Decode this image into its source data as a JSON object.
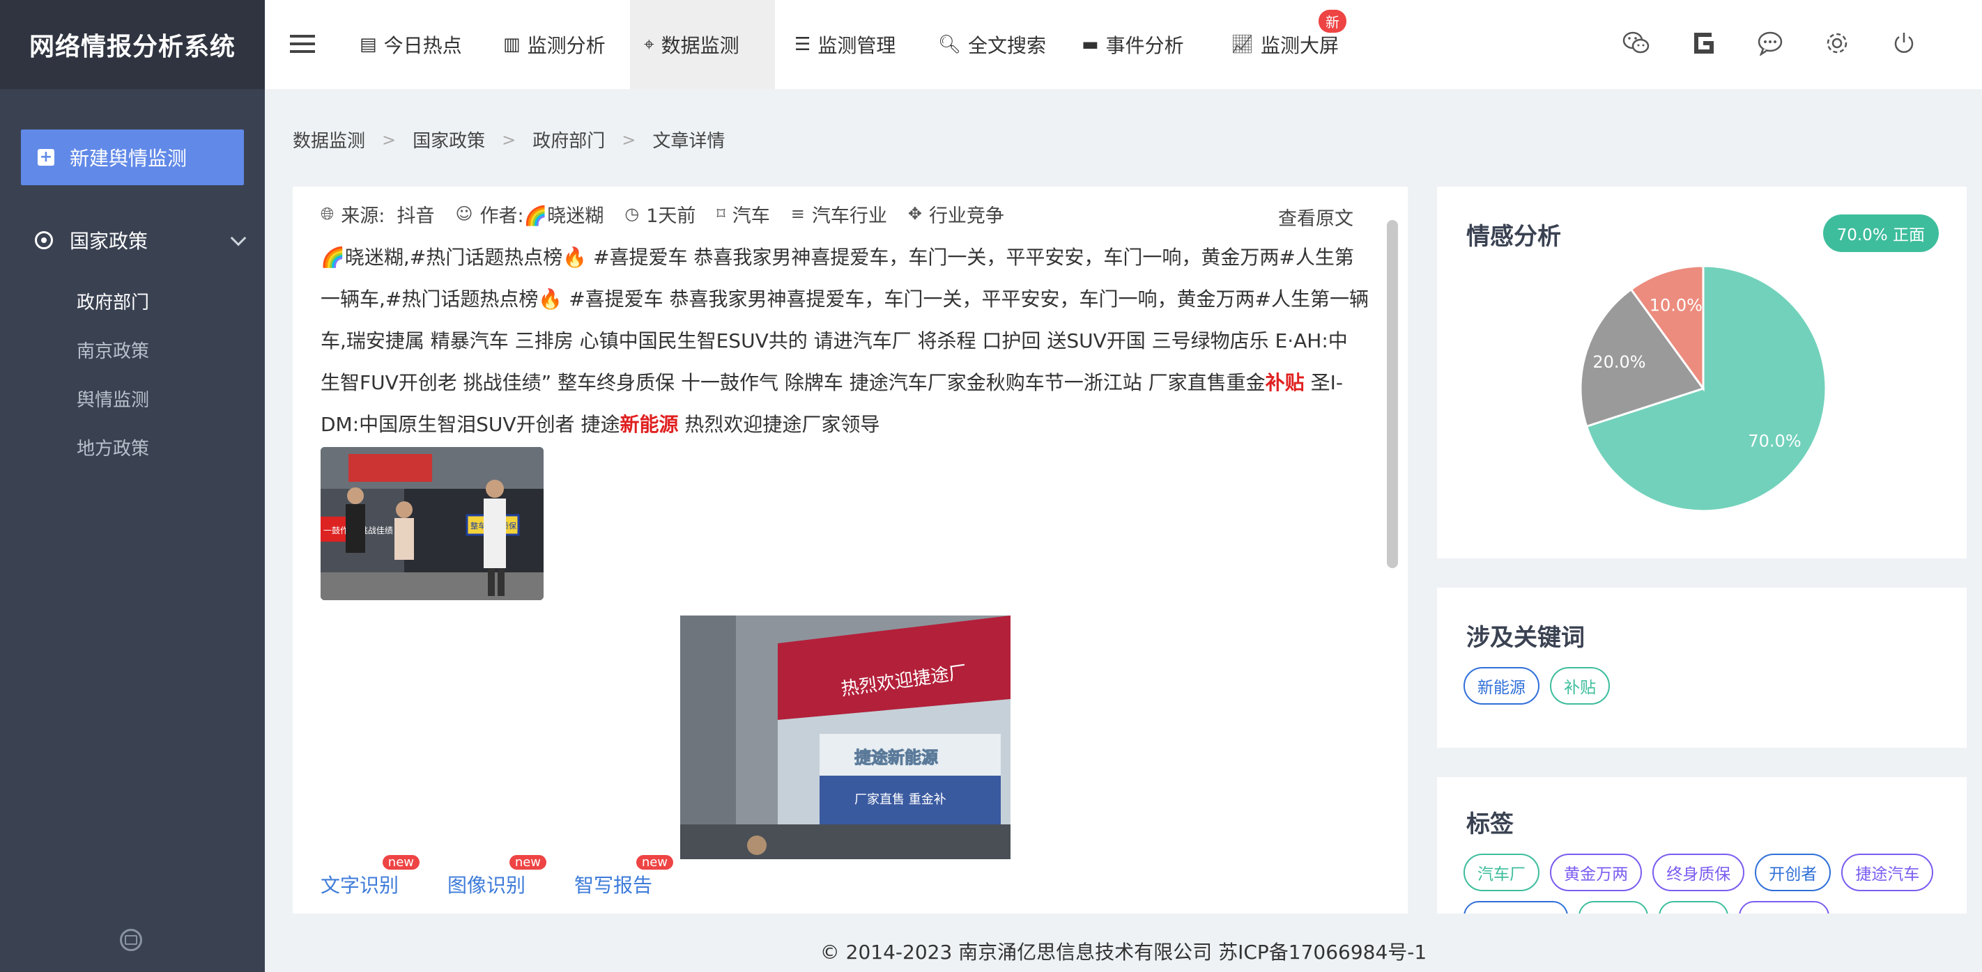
{
  "brand": "网络情报分析系统",
  "sidebar": {
    "new_button": "新建舆情监测",
    "group_label": "国家政策",
    "items": [
      {
        "label": "政府部门"
      },
      {
        "label": "南京政策"
      },
      {
        "label": "舆情监测"
      },
      {
        "label": "地方政策"
      }
    ]
  },
  "topnav": {
    "items": [
      {
        "label": "今日热点",
        "icon": "list-alt-icon"
      },
      {
        "label": "监测分析",
        "icon": "bar-chart-icon"
      },
      {
        "label": "数据监测",
        "icon": "crosshair-icon"
      },
      {
        "label": "监测管理",
        "icon": "list-icon"
      },
      {
        "label": "全文搜索",
        "icon": "search-icon"
      },
      {
        "label": "事件分析",
        "icon": "card-icon"
      },
      {
        "label": "监测大屏",
        "icon": "line-chart-icon"
      }
    ],
    "new_badge": "新"
  },
  "breadcrumb": [
    "数据监测",
    "国家政策",
    "政府部门",
    "文章详情"
  ],
  "article": {
    "source_label": "来源:",
    "source": "抖音",
    "author_label": "作者:",
    "author": "🌈晓迷糊",
    "time": "1天前",
    "category": "汽车",
    "industry": "汽车行业",
    "topic": "行业竞争",
    "view_original": "查看原文",
    "body_part1": "🌈晓迷糊,#热门话题热点榜🔥 #喜提爱车 恭喜我家男神喜提爱车，车门一关，平平安安，车门一响，黄金万两#人生第一辆车,#热门话题热点榜🔥 #喜提爱车 恭喜我家男神喜提爱车，车门一关，平平安安，车门一响，黄金万两#人生第一辆车,瑞安捷属 精暴汽车 三排房 心镇中国民生智ESUV共的 请进汽车厂 将杀程 口护回 送SUV开国 三号绿物店乐 E·AH:中 生智FUV开创老 挑战佳绩” 整车终身质保 十一鼓作气 除牌车 捷途汽车厂家金秋购车节一浙江站 厂家直售重金",
    "highlight1": "补贴",
    "body_part2": " 圣I-DM:中国原生智泪SUV开创者 捷途",
    "highlight2": "新能源",
    "body_part3": " 热烈欢迎捷途厂家领导",
    "img2_banner": "热烈欢迎捷途厂",
    "img2_sign": "捷途新能源",
    "img2_sub": "厂家直售 重金补",
    "img1_sign_left": "一鼓作气 挑战佳绩",
    "img1_sign_right": "整车终身质保"
  },
  "tools": [
    {
      "label": "文字识别",
      "badge": "new"
    },
    {
      "label": "图像识别",
      "badge": "new"
    },
    {
      "label": "智写报告",
      "badge": "new"
    }
  ],
  "sentiment": {
    "title": "情感分析",
    "badge": "70.0% 正面"
  },
  "chart_data": {
    "type": "pie",
    "slices": [
      {
        "label": "70.0%",
        "value": 70.0,
        "color": "#72d1bb"
      },
      {
        "label": "20.0%",
        "value": 20.0,
        "color": "#9a9a9a"
      },
      {
        "label": "10.0%",
        "value": 10.0,
        "color": "#ec8c7e"
      }
    ]
  },
  "keywords": {
    "title": "涉及关键词",
    "items": [
      {
        "label": "新能源",
        "color": "blue"
      },
      {
        "label": "补贴",
        "color": "green"
      }
    ]
  },
  "tags": {
    "title": "标签",
    "items": [
      {
        "label": "汽车厂",
        "color": "green"
      },
      {
        "label": "黄金万两",
        "color": "purple"
      },
      {
        "label": "终身质保",
        "color": "purple"
      },
      {
        "label": "开创者",
        "color": "blue"
      },
      {
        "label": "捷途汽车",
        "color": "purple"
      }
    ]
  },
  "footer": "© 2014-2023 南京涌亿思信息技术有限公司 苏ICP备17066984号-1"
}
